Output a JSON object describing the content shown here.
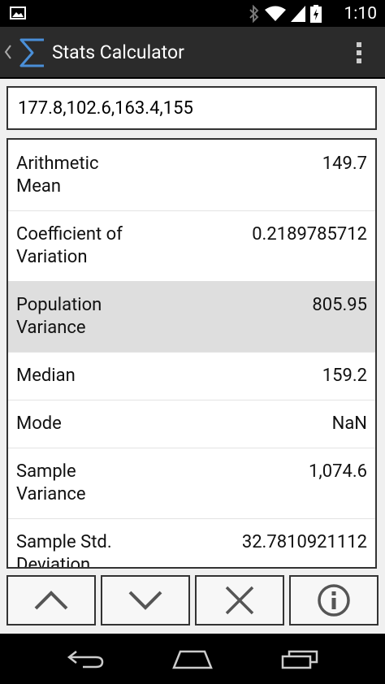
{
  "status": {
    "time": "1:10"
  },
  "app": {
    "title": "Stats Calculator"
  },
  "input": {
    "value": "177.8,102.6,163.4,155"
  },
  "results": [
    {
      "label": "Arithmetic\nMean",
      "value": "149.7"
    },
    {
      "label": "Coefficient of\nVariation",
      "value": "0.2189785712"
    },
    {
      "label": "Population\nVariance",
      "value": "805.95",
      "selected": true
    },
    {
      "label": "Median",
      "value": "159.2"
    },
    {
      "label": "Mode",
      "value": "NaN"
    },
    {
      "label": "Sample\nVariance",
      "value": "1,074.6"
    },
    {
      "label": "Sample Std.\nDeviation",
      "value": "32.7810921112"
    }
  ],
  "buttons": [
    "up-icon",
    "down-icon",
    "clear-icon",
    "info-icon"
  ],
  "nav": [
    "back-nav-icon",
    "home-nav-icon",
    "recents-nav-icon"
  ]
}
